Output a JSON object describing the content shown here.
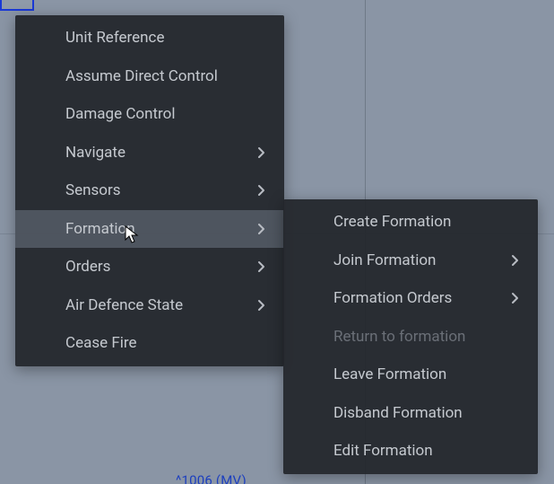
{
  "map": {
    "bottom_label": "^1006 (MV)"
  },
  "menu": {
    "items": [
      {
        "label": "Unit Reference",
        "submenu": false,
        "highlight": false,
        "disabled": false
      },
      {
        "label": "Assume Direct Control",
        "submenu": false,
        "highlight": false,
        "disabled": false
      },
      {
        "label": "Damage Control",
        "submenu": false,
        "highlight": false,
        "disabled": false
      },
      {
        "label": "Navigate",
        "submenu": true,
        "highlight": false,
        "disabled": false
      },
      {
        "label": "Sensors",
        "submenu": true,
        "highlight": false,
        "disabled": false
      },
      {
        "label": "Formation",
        "submenu": true,
        "highlight": true,
        "disabled": false
      },
      {
        "label": "Orders",
        "submenu": true,
        "highlight": false,
        "disabled": false
      },
      {
        "label": "Air Defence State",
        "submenu": true,
        "highlight": false,
        "disabled": false
      },
      {
        "label": "Cease Fire",
        "submenu": false,
        "highlight": false,
        "disabled": false
      }
    ]
  },
  "submenu": {
    "items": [
      {
        "label": "Create Formation",
        "submenu": false,
        "disabled": false
      },
      {
        "label": "Join Formation",
        "submenu": true,
        "disabled": false
      },
      {
        "label": "Formation Orders",
        "submenu": true,
        "disabled": false
      },
      {
        "label": "Return to formation",
        "submenu": false,
        "disabled": true
      },
      {
        "label": "Leave Formation",
        "submenu": false,
        "disabled": false
      },
      {
        "label": "Disband Formation",
        "submenu": false,
        "disabled": false
      },
      {
        "label": "Edit Formation",
        "submenu": false,
        "disabled": false
      }
    ]
  }
}
